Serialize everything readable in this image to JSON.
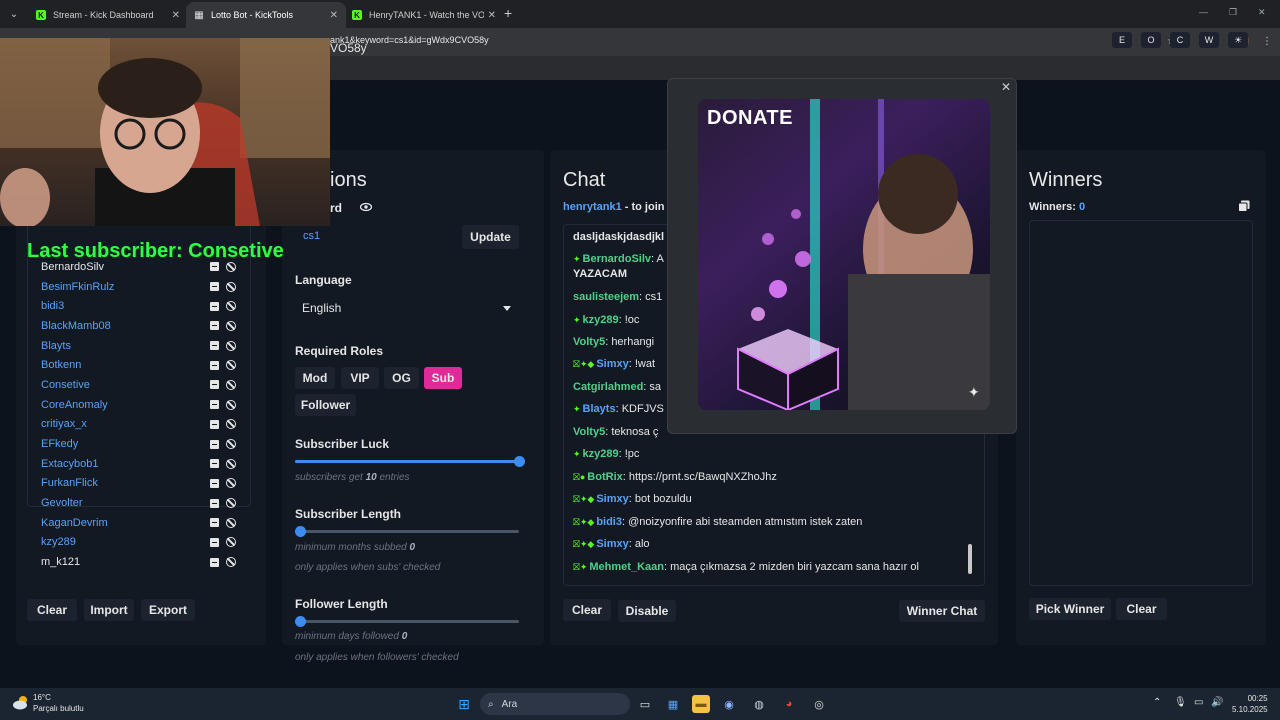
{
  "browser": {
    "tabs": [
      {
        "label": "Stream - Kick Dashboard",
        "icon": "kick-icon",
        "active": false
      },
      {
        "label": "Lotto Bot - KickTools",
        "icon": "grid-icon",
        "active": true
      },
      {
        "label": "HenryTANK1 - Watch the VOD",
        "icon": "kick-icon",
        "active": false
      }
    ],
    "url": "ank1&keyword=cs1&id=gWdx9CVO58y"
  },
  "page": {
    "id_fragment": "VO58y",
    "top_buttons": [
      "E",
      "O",
      "C",
      "W",
      "☀"
    ]
  },
  "overlay": {
    "last_subscriber": "Last subscriber: Consetive"
  },
  "users": {
    "list": [
      {
        "name": "BernardoSilv",
        "color": "white"
      },
      {
        "name": "BesimFkinRulz",
        "color": "blue"
      },
      {
        "name": "bidi3",
        "color": "blue"
      },
      {
        "name": "BlackMamb08",
        "color": "blue"
      },
      {
        "name": "Blayts",
        "color": "blue"
      },
      {
        "name": "Botkenn",
        "color": "blue"
      },
      {
        "name": "Consetive",
        "color": "blue"
      },
      {
        "name": "CoreAnomaly",
        "color": "blue"
      },
      {
        "name": "critiyax_x",
        "color": "blue"
      },
      {
        "name": "EFkedy",
        "color": "blue"
      },
      {
        "name": "Extacybob1",
        "color": "blue"
      },
      {
        "name": "FurkanFlick",
        "color": "blue"
      },
      {
        "name": "Gevolter",
        "color": "blue"
      },
      {
        "name": "KaganDevrim",
        "color": "blue"
      },
      {
        "name": "kzy289",
        "color": "blue"
      },
      {
        "name": "m_k121",
        "color": "white"
      }
    ],
    "clear_label": "Clear",
    "import_label": "Import",
    "export_label": "Export"
  },
  "options": {
    "title_fragment": "ions",
    "keyword_label_fragment": "rd",
    "keyword_value": "cs1",
    "update_label": "Update",
    "language_label": "Language",
    "language_value": "English",
    "roles_label": "Required Roles",
    "roles": [
      {
        "label": "Mod",
        "on": false
      },
      {
        "label": "VIP",
        "on": false
      },
      {
        "label": "OG",
        "on": false
      },
      {
        "label": "Sub",
        "on": true
      },
      {
        "label": "Follower",
        "on": false
      }
    ],
    "sub_luck_label": "Subscriber Luck",
    "sub_luck_value": 10,
    "sub_luck_max": 10,
    "sub_luck_hint_pre": "subscribers get ",
    "sub_luck_hint_val": "10",
    "sub_luck_hint_post": " entries",
    "sub_length_label": "Subscriber Length",
    "sub_length_value": 0,
    "sub_length_hint_pre": "minimum months subbed ",
    "sub_length_hint_val": "0",
    "sub_length_hint2": "only applies when subs' checked",
    "follower_length_label": "Follower Length",
    "follower_length_value": 0,
    "follower_length_hint_pre": "minimum days followed ",
    "follower_length_hint_val": "0",
    "follower_length_hint2": "only applies when followers' checked"
  },
  "chat": {
    "title": "Chat",
    "join_user": "henrytank1",
    "join_text": " - to join",
    "messages": [
      {
        "user": "",
        "text": "dasljdaskjdasdjkl",
        "badges": "",
        "ucolor": "#e6e6e6"
      },
      {
        "user": "BernardoSilv",
        "text": ": A",
        "badges": "✦",
        "ucolor": "#4fd08a"
      },
      {
        "user": "",
        "text": "YAZACAM",
        "badges": "",
        "ucolor": "#e6e6e6"
      },
      {
        "user": "saulisteejem",
        "text": ": cs1",
        "badges": "",
        "ucolor": "#4fd08a"
      },
      {
        "user": "kzy289",
        "text": ": !oc",
        "badges": "✦",
        "ucolor": "#4fd08a"
      },
      {
        "user": "Volty5",
        "text": ": herhangi",
        "badges": "",
        "ucolor": "#4fd08a"
      },
      {
        "user": "Simxy",
        "text": ": !wat",
        "badges": "⛝✦◆",
        "ucolor": "#5aa2f5"
      },
      {
        "user": "Catgirlahmed",
        "text": ": sa",
        "badges": "",
        "ucolor": "#4fd08a"
      },
      {
        "user": "Blayts",
        "text": ": KDFJVS",
        "badges": "✦",
        "ucolor": "#5aa2f5"
      },
      {
        "user": "Volty5",
        "text": ": teknosa ç",
        "badges": "",
        "ucolor": "#4fd08a"
      },
      {
        "user": "kzy289",
        "text": ": !pc",
        "badges": "✦",
        "ucolor": "#4fd08a"
      },
      {
        "user": "BotRix",
        "text": ": https://prnt.sc/BawqNXZhoJhz",
        "badges": "⛝●",
        "ucolor": "#4fd08a"
      },
      {
        "user": "Simxy",
        "text": ": bot bozuldu",
        "badges": "⛝✦◆",
        "ucolor": "#5aa2f5"
      },
      {
        "user": "bidi3",
        "text": ": @noizyonfire abi steamden atmıstım istek zaten",
        "badges": "⛝✦◆",
        "ucolor": "#5aa2f5"
      },
      {
        "user": "Simxy",
        "text": ": alo",
        "badges": "⛝✦◆",
        "ucolor": "#5aa2f5"
      },
      {
        "user": "Mehmet_Kaan",
        "text": ": maça çıkmazsa 2 mizden biri yazcam sana hazır ol",
        "badges": "⛝✦",
        "ucolor": "#4fd08a"
      }
    ],
    "clear_label": "Clear",
    "disable_label": "Disable",
    "winner_chat_label": "Winner Chat"
  },
  "winners": {
    "title": "Winners",
    "count_label": "Winners:",
    "count": "0",
    "pick_label": "Pick Winner",
    "clear_label": "Clear"
  },
  "donate": {
    "label": "DONATE"
  },
  "taskbar": {
    "temperature": "16°C",
    "weather": "Parçalı bulutlu",
    "search_placeholder": "Ara",
    "time": "00:25",
    "date": "5.10.2025"
  }
}
